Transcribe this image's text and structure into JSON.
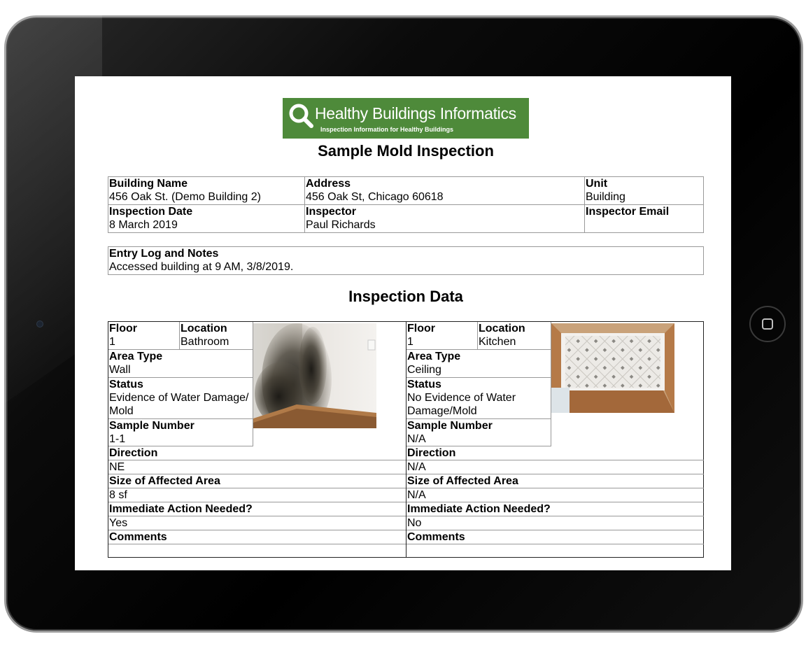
{
  "logo": {
    "name": "Healthy Buildings Informatics",
    "tagline": "Inspection Information for Healthy Buildings"
  },
  "document": {
    "title": "Sample Mold Inspection",
    "section_title": "Inspection Data"
  },
  "building_info": {
    "building_name_label": "Building Name",
    "building_name": "456 Oak St. (Demo Building 2)",
    "address_label": "Address",
    "address": "456 Oak St, Chicago 60618",
    "unit_label": "Unit",
    "unit": "Building",
    "inspection_date_label": "Inspection Date",
    "inspection_date": "8 March 2019",
    "inspector_label": "Inspector",
    "inspector": "Paul Richards",
    "inspector_email_label": "Inspector Email",
    "inspector_email": ""
  },
  "notes": {
    "label": "Entry Log and Notes",
    "text": "Accessed building at 9 AM, 3/8/2019."
  },
  "labels": {
    "floor": "Floor",
    "location": "Location",
    "area_type": "Area Type",
    "status": "Status",
    "sample_number": "Sample Number",
    "direction": "Direction",
    "size": "Size of Affected Area",
    "action": "Immediate Action Needed?",
    "comments": "Comments"
  },
  "inspections": [
    {
      "floor": "1",
      "location": "Bathroom",
      "area_type": "Wall",
      "status": "Evidence of Water Damage/ Mold",
      "sample_number": "1-1",
      "direction": "NE",
      "size": "8 sf",
      "action": "Yes",
      "comments": ""
    },
    {
      "floor": "1",
      "location": "Kitchen",
      "area_type": "Ceiling",
      "status": "No Evidence of Water Damage/Mold",
      "sample_number": "N/A",
      "direction": "N/A",
      "size": "N/A",
      "action": "No",
      "comments": ""
    }
  ],
  "colors": {
    "logo_green": "#4e8a3a",
    "bezel": "#000000"
  },
  "icons": {
    "home_button": "home-square-icon",
    "logo_mark": "magnifier-icon"
  }
}
